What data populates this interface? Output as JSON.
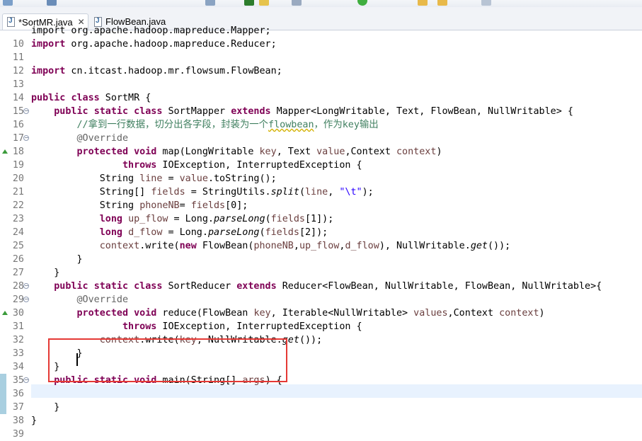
{
  "tabs": [
    {
      "label": "*SortMR.java",
      "active": true
    },
    {
      "label": "FlowBean.java",
      "active": false
    }
  ],
  "editor": {
    "lines": [
      {
        "num": "",
        "tokens": [
          {
            "t": "import org.apache.hadoop.mapreduce.Mapper;",
            "c": ""
          }
        ]
      },
      {
        "num": "10",
        "tokens": [
          {
            "t": "import",
            "c": "kw"
          },
          {
            "t": " org.apache.hadoop.mapreduce.Reducer;",
            "c": ""
          }
        ]
      },
      {
        "num": "11",
        "tokens": []
      },
      {
        "num": "12",
        "tokens": [
          {
            "t": "import",
            "c": "kw"
          },
          {
            "t": " cn.itcast.hadoop.mr.flowsum.FlowBean;",
            "c": ""
          }
        ]
      },
      {
        "num": "13",
        "tokens": []
      },
      {
        "num": "14",
        "tokens": [
          {
            "t": "public",
            "c": "kw"
          },
          {
            "t": " ",
            "c": ""
          },
          {
            "t": "class",
            "c": "kw"
          },
          {
            "t": " SortMR {",
            "c": ""
          }
        ]
      },
      {
        "num": "15",
        "fold": true,
        "tokens": [
          {
            "t": "    ",
            "c": ""
          },
          {
            "t": "public",
            "c": "kw"
          },
          {
            "t": " ",
            "c": ""
          },
          {
            "t": "static",
            "c": "kw"
          },
          {
            "t": " ",
            "c": ""
          },
          {
            "t": "class",
            "c": "kw"
          },
          {
            "t": " SortMapper ",
            "c": ""
          },
          {
            "t": "extends",
            "c": "kw"
          },
          {
            "t": " Mapper<LongWritable, Text, FlowBean, NullWritable> {",
            "c": ""
          }
        ]
      },
      {
        "num": "16",
        "tokens": [
          {
            "t": "        //拿到一行数据，切分出各字段，封装为一个",
            "c": "cm"
          },
          {
            "t": "flowbean",
            "c": "cm sq"
          },
          {
            "t": "，作为key输出",
            "c": "cm"
          }
        ]
      },
      {
        "num": "17",
        "fold": true,
        "tokens": [
          {
            "t": "        ",
            "c": ""
          },
          {
            "t": "@Override",
            "c": "an"
          }
        ]
      },
      {
        "num": "18",
        "override": true,
        "tokens": [
          {
            "t": "        ",
            "c": ""
          },
          {
            "t": "protected",
            "c": "kw"
          },
          {
            "t": " ",
            "c": ""
          },
          {
            "t": "void",
            "c": "kw"
          },
          {
            "t": " map(LongWritable ",
            "c": ""
          },
          {
            "t": "key",
            "c": "var"
          },
          {
            "t": ", Text ",
            "c": ""
          },
          {
            "t": "value",
            "c": "var"
          },
          {
            "t": ",Context ",
            "c": ""
          },
          {
            "t": "context",
            "c": "var"
          },
          {
            "t": ")",
            "c": ""
          }
        ]
      },
      {
        "num": "19",
        "tokens": [
          {
            "t": "                ",
            "c": ""
          },
          {
            "t": "throws",
            "c": "kw"
          },
          {
            "t": " IOException, InterruptedException {",
            "c": ""
          }
        ]
      },
      {
        "num": "20",
        "tokens": [
          {
            "t": "            String ",
            "c": ""
          },
          {
            "t": "line",
            "c": "var"
          },
          {
            "t": " = ",
            "c": ""
          },
          {
            "t": "value",
            "c": "var"
          },
          {
            "t": ".toString();",
            "c": ""
          }
        ]
      },
      {
        "num": "21",
        "tokens": [
          {
            "t": "            String[] ",
            "c": ""
          },
          {
            "t": "fields",
            "c": "var"
          },
          {
            "t": " = StringUtils.",
            "c": ""
          },
          {
            "t": "split",
            "c": "it"
          },
          {
            "t": "(",
            "c": ""
          },
          {
            "t": "line",
            "c": "var"
          },
          {
            "t": ", ",
            "c": ""
          },
          {
            "t": "\"\\t\"",
            "c": "str"
          },
          {
            "t": ");",
            "c": ""
          }
        ]
      },
      {
        "num": "22",
        "tokens": [
          {
            "t": "            String ",
            "c": ""
          },
          {
            "t": "phoneNB",
            "c": "var"
          },
          {
            "t": "= ",
            "c": ""
          },
          {
            "t": "fields",
            "c": "var"
          },
          {
            "t": "[0];",
            "c": ""
          }
        ]
      },
      {
        "num": "23",
        "tokens": [
          {
            "t": "            ",
            "c": ""
          },
          {
            "t": "long",
            "c": "kw"
          },
          {
            "t": " ",
            "c": ""
          },
          {
            "t": "up_flow",
            "c": "var"
          },
          {
            "t": " = Long.",
            "c": ""
          },
          {
            "t": "parseLong",
            "c": "it"
          },
          {
            "t": "(",
            "c": ""
          },
          {
            "t": "fields",
            "c": "var"
          },
          {
            "t": "[1]);",
            "c": ""
          }
        ]
      },
      {
        "num": "24",
        "tokens": [
          {
            "t": "            ",
            "c": ""
          },
          {
            "t": "long",
            "c": "kw"
          },
          {
            "t": " ",
            "c": ""
          },
          {
            "t": "d_flow",
            "c": "var"
          },
          {
            "t": " = Long.",
            "c": ""
          },
          {
            "t": "parseLong",
            "c": "it"
          },
          {
            "t": "(",
            "c": ""
          },
          {
            "t": "fields",
            "c": "var"
          },
          {
            "t": "[2]);",
            "c": ""
          }
        ]
      },
      {
        "num": "25",
        "tokens": [
          {
            "t": "            ",
            "c": ""
          },
          {
            "t": "context",
            "c": "var"
          },
          {
            "t": ".write(",
            "c": ""
          },
          {
            "t": "new",
            "c": "kw"
          },
          {
            "t": " FlowBean(",
            "c": ""
          },
          {
            "t": "phoneNB",
            "c": "var"
          },
          {
            "t": ",",
            "c": ""
          },
          {
            "t": "up_flow",
            "c": "var"
          },
          {
            "t": ",",
            "c": ""
          },
          {
            "t": "d_flow",
            "c": "var"
          },
          {
            "t": "), NullWritable.",
            "c": ""
          },
          {
            "t": "get",
            "c": "it"
          },
          {
            "t": "());",
            "c": ""
          }
        ]
      },
      {
        "num": "26",
        "tokens": [
          {
            "t": "        }",
            "c": ""
          }
        ]
      },
      {
        "num": "27",
        "tokens": [
          {
            "t": "    }",
            "c": ""
          }
        ]
      },
      {
        "num": "28",
        "fold": true,
        "tokens": [
          {
            "t": "    ",
            "c": ""
          },
          {
            "t": "public",
            "c": "kw"
          },
          {
            "t": " ",
            "c": ""
          },
          {
            "t": "static",
            "c": "kw"
          },
          {
            "t": " ",
            "c": ""
          },
          {
            "t": "class",
            "c": "kw"
          },
          {
            "t": " SortReducer ",
            "c": ""
          },
          {
            "t": "extends",
            "c": "kw"
          },
          {
            "t": " Reducer<FlowBean, NullWritable, FlowBean, NullWritable>{",
            "c": ""
          }
        ]
      },
      {
        "num": "29",
        "fold": true,
        "tokens": [
          {
            "t": "        ",
            "c": ""
          },
          {
            "t": "@Override",
            "c": "an"
          }
        ]
      },
      {
        "num": "30",
        "override": true,
        "tokens": [
          {
            "t": "        ",
            "c": ""
          },
          {
            "t": "protected",
            "c": "kw"
          },
          {
            "t": " ",
            "c": ""
          },
          {
            "t": "void",
            "c": "kw"
          },
          {
            "t": " reduce(FlowBean ",
            "c": ""
          },
          {
            "t": "key",
            "c": "var"
          },
          {
            "t": ", Iterable<NullWritable> ",
            "c": ""
          },
          {
            "t": "values",
            "c": "var"
          },
          {
            "t": ",Context ",
            "c": ""
          },
          {
            "t": "context",
            "c": "var"
          },
          {
            "t": ")",
            "c": ""
          }
        ]
      },
      {
        "num": "31",
        "tokens": [
          {
            "t": "                ",
            "c": ""
          },
          {
            "t": "throws",
            "c": "kw"
          },
          {
            "t": " IOException, InterruptedException {",
            "c": ""
          }
        ]
      },
      {
        "num": "32",
        "tokens": [
          {
            "t": "            ",
            "c": ""
          },
          {
            "t": "context",
            "c": "var"
          },
          {
            "t": ".write(",
            "c": ""
          },
          {
            "t": "key",
            "c": "var"
          },
          {
            "t": ", NullWritable.",
            "c": ""
          },
          {
            "t": "get",
            "c": "it"
          },
          {
            "t": "());",
            "c": ""
          }
        ]
      },
      {
        "num": "33",
        "tokens": [
          {
            "t": "        }",
            "c": ""
          }
        ]
      },
      {
        "num": "34",
        "tokens": [
          {
            "t": "    }",
            "c": ""
          }
        ]
      },
      {
        "num": "35",
        "fold": true,
        "diff": true,
        "tokens": [
          {
            "t": "    ",
            "c": ""
          },
          {
            "t": "public",
            "c": "kw"
          },
          {
            "t": " ",
            "c": ""
          },
          {
            "t": "static",
            "c": "kw"
          },
          {
            "t": " ",
            "c": ""
          },
          {
            "t": "void",
            "c": "kw"
          },
          {
            "t": " main(String[] ",
            "c": ""
          },
          {
            "t": "args",
            "c": "var"
          },
          {
            "t": ") {",
            "c": ""
          }
        ]
      },
      {
        "num": "36",
        "diff": true,
        "tokens": []
      },
      {
        "num": "37",
        "diff": true,
        "tokens": [
          {
            "t": "    }",
            "c": ""
          }
        ]
      },
      {
        "num": "38",
        "tokens": [
          {
            "t": "}",
            "c": ""
          }
        ]
      },
      {
        "num": "39",
        "tokens": []
      }
    ]
  }
}
